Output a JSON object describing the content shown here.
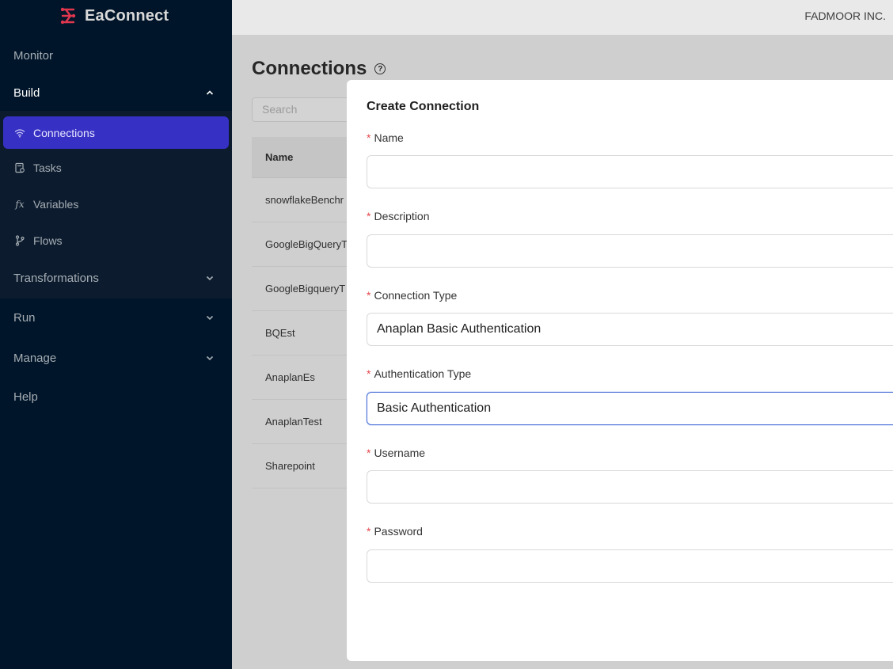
{
  "app": {
    "name": "EaConnect",
    "org": "FADMOOR INC."
  },
  "sidebar": {
    "menus": [
      {
        "label": "Monitor"
      },
      {
        "label": "Build",
        "expanded": true
      },
      {
        "label": "Transformations"
      },
      {
        "label": "Run"
      },
      {
        "label": "Manage"
      },
      {
        "label": "Help"
      }
    ],
    "build_items": [
      {
        "label": "Connections",
        "icon": "wifi-icon",
        "active": true
      },
      {
        "label": "Tasks",
        "icon": "task-icon"
      },
      {
        "label": "Variables",
        "icon": "fx-icon",
        "icon_text": "fx"
      },
      {
        "label": "Flows",
        "icon": "branch-icon"
      }
    ]
  },
  "page": {
    "title": "Connections",
    "search_placeholder": "Search",
    "table": {
      "columns": [
        "Name"
      ],
      "rows": [
        "snowflakeBenchr",
        "GoogleBigQueryT",
        "GoogleBigqueryT",
        "BQEst",
        "AnaplanEs",
        "AnaplanTest",
        "Sharepoint"
      ]
    }
  },
  "modal": {
    "title": "Create Connection",
    "fields": [
      {
        "label": "Name",
        "value": ""
      },
      {
        "label": "Description",
        "value": ""
      },
      {
        "label": "Connection Type",
        "value": "Anaplan Basic Authentication"
      },
      {
        "label": "Authentication Type",
        "value": "Basic Authentication",
        "focused": true
      },
      {
        "label": "Username",
        "value": ""
      },
      {
        "label": "Password",
        "value": ""
      }
    ],
    "required_marker": "*"
  },
  "colors": {
    "sidebar_bg": "#001529",
    "active_item": "#3730c4",
    "brand_red": "#e0374f",
    "required": "#e5484d",
    "focus_border": "#4a6fd6"
  }
}
